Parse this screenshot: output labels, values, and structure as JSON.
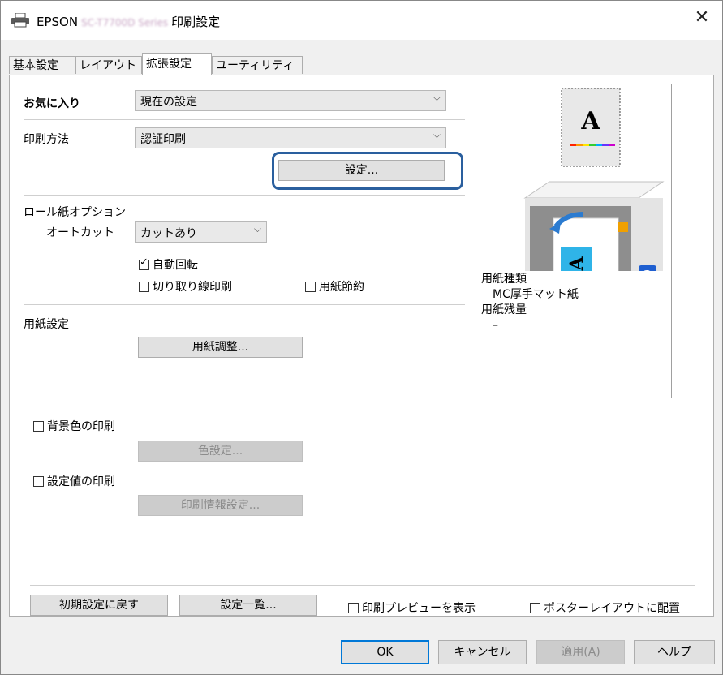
{
  "window": {
    "title_prefix": "EPSON",
    "title_model": "SC-T7700D Series",
    "title_suffix": "印刷設定",
    "close_glyph": "✕"
  },
  "tabs": [
    {
      "label": "基本設定"
    },
    {
      "label": "レイアウト"
    },
    {
      "label": "拡張設定"
    },
    {
      "label": "ユーティリティー"
    }
  ],
  "favorites": {
    "label": "お気に入り",
    "value": "現在の設定"
  },
  "print_method": {
    "label": "印刷方法",
    "value": "認証印刷",
    "settings_button": "設定..."
  },
  "roll": {
    "section_label": "ロール紙オプション",
    "autocut_label": "オートカット",
    "autocut_value": "カットあり",
    "auto_rotate": "自動回転",
    "cut_line": "切り取り線印刷",
    "paper_save": "用紙節約"
  },
  "paper": {
    "section_label": "用紙設定",
    "adjust_button": "用紙調整..."
  },
  "background": {
    "label": "背景色の印刷",
    "color_button": "色設定..."
  },
  "setting_values": {
    "label": "設定値の印刷",
    "info_button": "印刷情報設定..."
  },
  "preview": {
    "letter": "A",
    "rotated_letter": "A",
    "badge": "2",
    "media_type_label": "用紙種類",
    "media_type_value": "MC厚手マット紙",
    "remaining_label": "用紙残量",
    "remaining_value": "–"
  },
  "footer": {
    "reset": "初期設定に戻す",
    "list": "設定一覧...",
    "show_preview": "印刷プレビューを表示",
    "poster": "ポスターレイアウトに配置"
  },
  "dialog": {
    "ok": "OK",
    "cancel": "キャンセル",
    "apply": "適用(A)",
    "help": "ヘルプ"
  },
  "colors": {
    "highlight": "#2a5f9e",
    "accent": "#0078d7",
    "printer_screen": "#2fb4e8"
  }
}
